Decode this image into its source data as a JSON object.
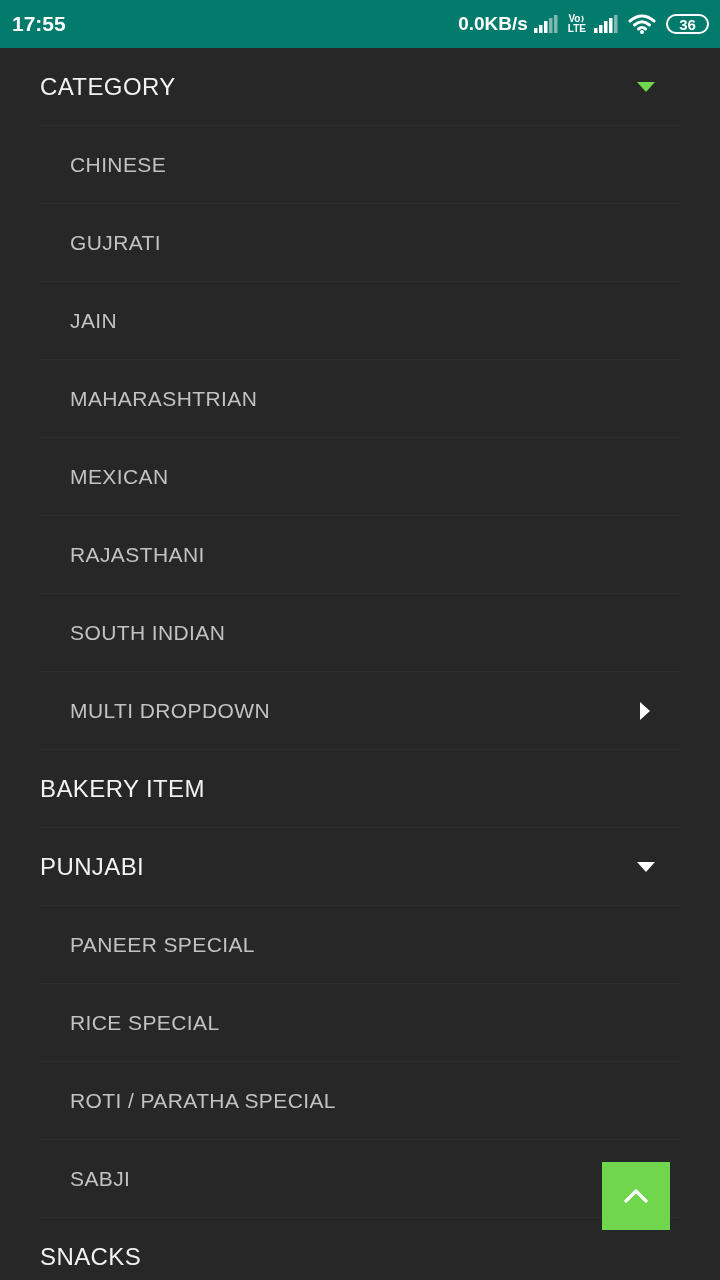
{
  "status_bar": {
    "time": "17:55",
    "network_speed": "0.0KB/s",
    "volte_top": "Vo",
    "volte_bottom": "LTE",
    "battery": "36"
  },
  "menu": {
    "items": [
      {
        "label": "CATEGORY",
        "selected": true,
        "expanded": true,
        "children": [
          {
            "label": "CHINESE"
          },
          {
            "label": "GUJRATI"
          },
          {
            "label": "JAIN"
          },
          {
            "label": "MAHARASHTRIAN"
          },
          {
            "label": "MEXICAN"
          },
          {
            "label": "RAJASTHANI"
          },
          {
            "label": "SOUTH INDIAN"
          },
          {
            "label": "MULTI DROPDOWN",
            "expanded": false
          }
        ]
      },
      {
        "label": "BAKERY ITEM",
        "selected": false
      },
      {
        "label": "PUNJABI",
        "selected": false,
        "expanded": true,
        "children": [
          {
            "label": "PANEER SPECIAL"
          },
          {
            "label": "RICE SPECIAL"
          },
          {
            "label": "ROTI / PARATHA SPECIAL"
          },
          {
            "label": "SABJI"
          }
        ]
      },
      {
        "label": "SNACKS",
        "selected": false
      }
    ]
  }
}
